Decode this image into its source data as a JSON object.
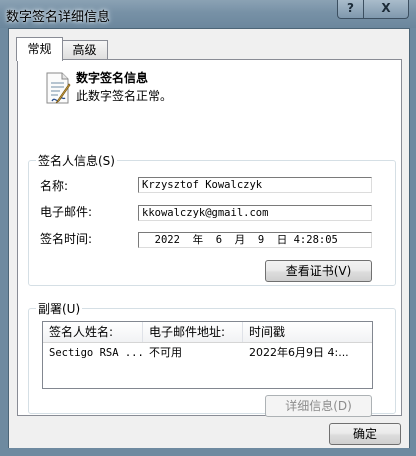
{
  "window": {
    "title": "数字签名详细信息",
    "help_glyph": "?",
    "close_glyph": "X"
  },
  "tabs": [
    {
      "label": "常规",
      "selected": true
    },
    {
      "label": "高级",
      "selected": false
    }
  ],
  "header": {
    "icon": "certificate-document-icon",
    "title": "数字签名信息",
    "subtitle": "此数字签名正常。"
  },
  "signer": {
    "legend": "签名人信息(S)",
    "name_label": "名称:",
    "name_value": "Krzysztof Kowalczyk",
    "email_label": "电子邮件:",
    "email_value": "kkowalczyk@gmail.com",
    "time_label": "签名时间:",
    "time_value": "  2022  年  6  月  9  日 4:28:05",
    "view_cert_button": "查看证书(V)"
  },
  "countersignatures": {
    "legend": "副署(U)",
    "columns": [
      "签名人姓名:",
      "电子邮件地址:",
      "时间戳"
    ],
    "rows": [
      [
        "Sectigo RSA ...",
        "不可用",
        "2022年6月9日 4:..."
      ]
    ],
    "details_button": "详细信息(D)"
  },
  "footer": {
    "ok_button": "确定"
  },
  "colors": {
    "titlebar": "#7791a6",
    "dialog_bg": "#f0f0f0",
    "panel_bg": "#ffffff"
  }
}
